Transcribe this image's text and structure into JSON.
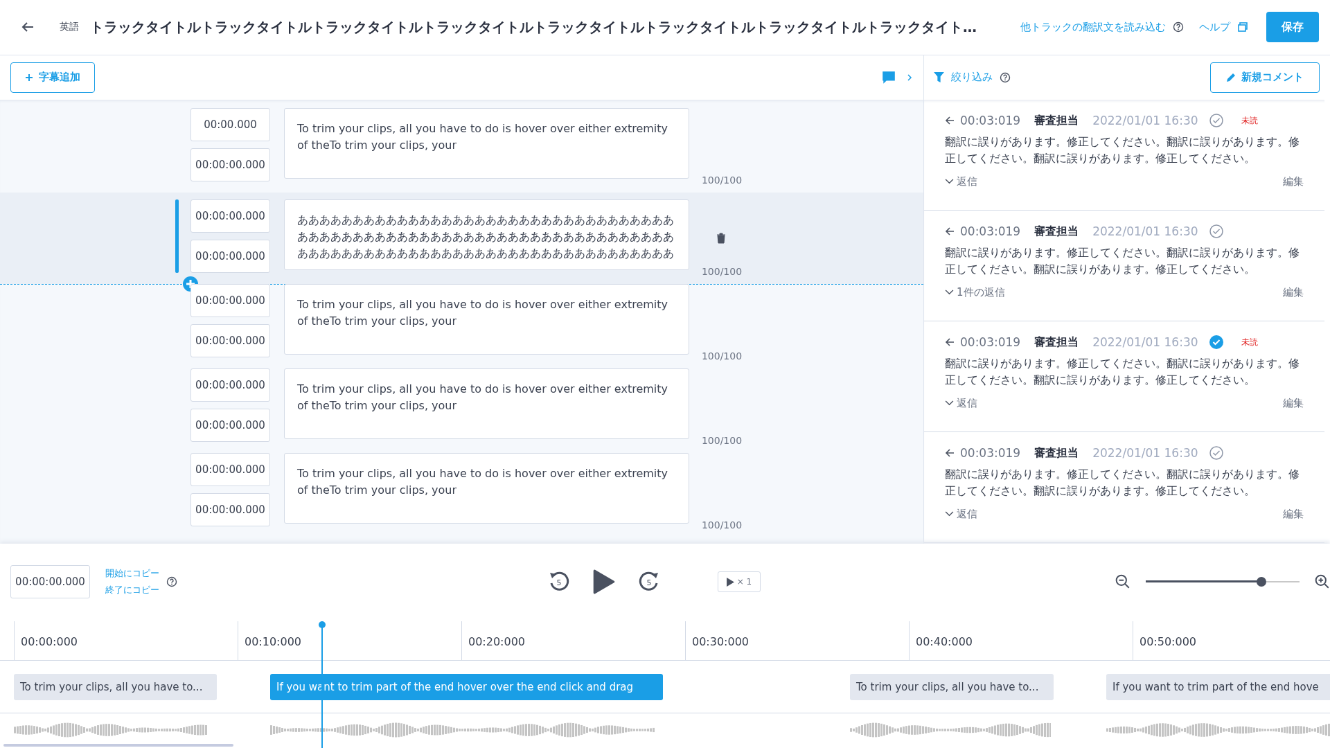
{
  "header": {
    "language": "英語",
    "title": "トラックタイトルトラックタイトルトラックタイトルトラックタイトルトラックタイトルトラックタイトルトラックタイトルトラックタイト…",
    "load_link": "他トラックの翻訳文を読み込む",
    "help_link": "ヘルプ",
    "save_button": "保存"
  },
  "toolbar": {
    "add_subtitle": "字幕追加",
    "filter": "絞り込み",
    "new_comment": "新規コメント"
  },
  "subtitles": [
    {
      "start": "00:00.000",
      "end": "00:00:00.000",
      "text": "To trim your clips, all you have to do is hover over either extremity of theTo trim your clips, your",
      "count": "100/100",
      "selected": false
    },
    {
      "start": "00:00:00.000",
      "end": "00:00:00.000",
      "text": "ああああああああああああああああああああああああああああああああああああああああああああああああああああああああああああああああああああああああああああああああああああああああああああああああああああああ",
      "count": "100/100",
      "selected": true
    },
    {
      "start": "00:00:00.000",
      "end": "00:00:00.000",
      "text": "To trim your clips, all you have to do is hover over either extremity of theTo trim your clips, your",
      "count": "100/100",
      "selected": false
    },
    {
      "start": "00:00:00.000",
      "end": "00:00:00.000",
      "text": "To trim your clips, all you have to do is hover over either extremity of theTo trim your clips, your",
      "count": "100/100",
      "selected": false
    },
    {
      "start": "00:00:00.000",
      "end": "00:00:00.000",
      "text": "To trim your clips, all you have to do is hover over either extremity of theTo trim your clips, your",
      "count": "100/100",
      "selected": false
    }
  ],
  "comments": [
    {
      "time": "00:03:019",
      "author": "審査担当",
      "date": "2022/01/01 16:30",
      "resolved": false,
      "unread": true,
      "unread_label": "未読",
      "body": "翻訳に誤りがあります。修正してください。翻訳に誤りがあります。修正してください。翻訳に誤りがあります。修正してください。",
      "replies": "返信",
      "edit": "編集"
    },
    {
      "time": "00:03:019",
      "author": "審査担当",
      "date": "2022/01/01 16:30",
      "resolved": false,
      "unread": false,
      "body": "翻訳に誤りがあります。修正してください。翻訳に誤りがあります。修正してください。翻訳に誤りがあります。修正してください。",
      "replies": "1件の返信",
      "edit": "編集"
    },
    {
      "time": "00:03:019",
      "author": "審査担当",
      "date": "2022/01/01 16:30",
      "resolved": true,
      "unread": true,
      "unread_label": "未読",
      "body": "翻訳に誤りがあります。修正してください。翻訳に誤りがあります。修正してください。翻訳に誤りがあります。修正してください。",
      "replies": "返信",
      "edit": "編集"
    },
    {
      "time": "00:03:019",
      "author": "審査担当",
      "date": "2022/01/01 16:30",
      "resolved": false,
      "unread": false,
      "body": "翻訳に誤りがあります。修正してください。翻訳に誤りがあります。修正してください。翻訳に誤りがあります。修正してください。",
      "replies": "返信",
      "edit": "編集"
    }
  ],
  "player": {
    "time": "00:00:00.000",
    "copy_start": "開始にコピー",
    "copy_end": "終了にコピー",
    "rewind_seconds": "5",
    "forward_seconds": "5",
    "speed": "× 1",
    "zoom": {
      "level": 0.75
    }
  },
  "timeline": {
    "ticks": [
      "00:00:000",
      "00:10:000",
      "00:20:000",
      "00:30:000",
      "00:40:000",
      "00:50:000"
    ],
    "clips": [
      {
        "text": "To trim your clips, all you have to...",
        "selected": false
      },
      {
        "text": "If you want to trim part of the end hover over the end click and drag",
        "selected": true
      },
      {
        "text": "To trim your clips, all you have to...",
        "selected": false
      },
      {
        "text": "If you want to trim part of the end hove",
        "selected": false
      }
    ]
  }
}
